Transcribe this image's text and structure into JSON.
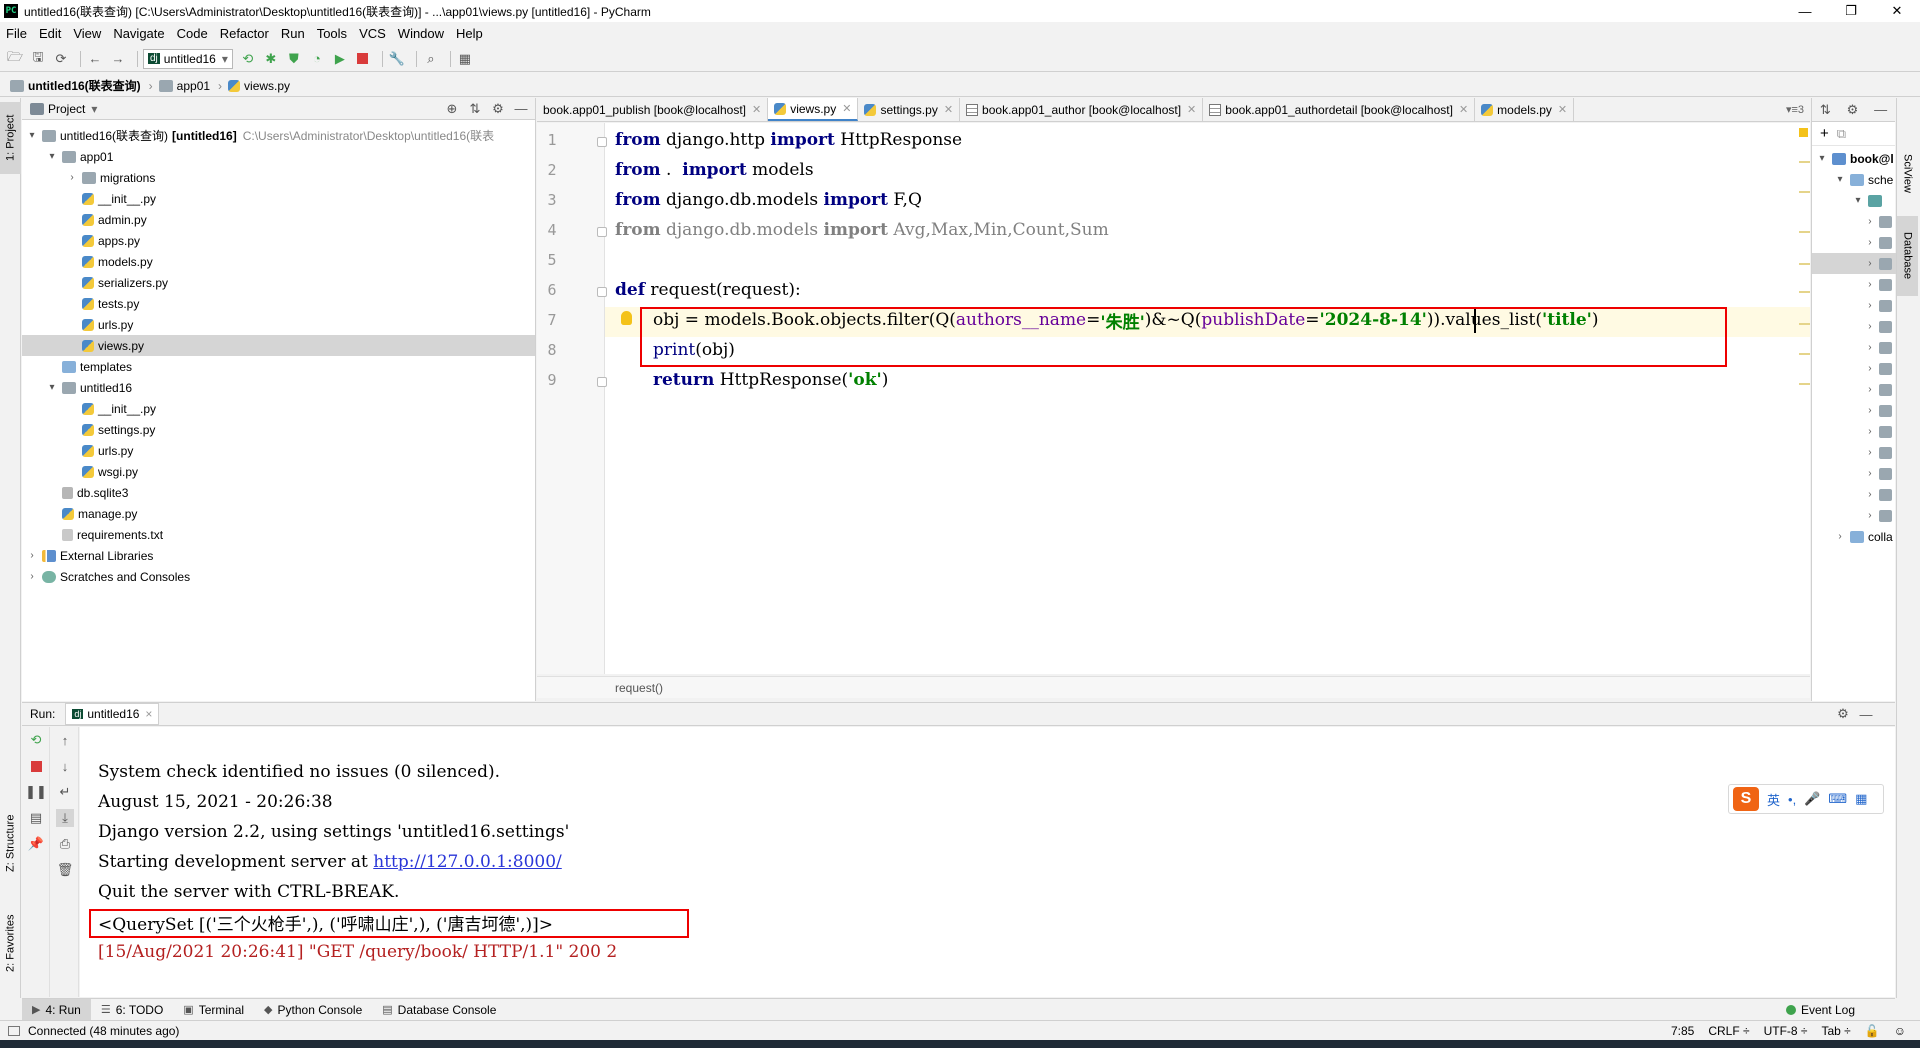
{
  "window": {
    "app_icon": "PC",
    "title": "untitled16(联表查询) [C:\\Users\\Administrator\\Desktop\\untitled16(联表查询)] - ...\\app01\\views.py [untitled16] - PyCharm",
    "minimize": "—",
    "restore": "❐",
    "close": "✕"
  },
  "menu": [
    "File",
    "Edit",
    "View",
    "Navigate",
    "Code",
    "Refactor",
    "Run",
    "Tools",
    "VCS",
    "Window",
    "Help"
  ],
  "toolbar": {
    "run_config": "untitled16",
    "run_config_arrow": "▾"
  },
  "navbar": {
    "crumbs": [
      "untitled16(联表查询)",
      "app01",
      "views.py"
    ]
  },
  "left_stripe": {
    "project": "1: Project",
    "structure": "Z: Structure",
    "favorites": "2: Favorites"
  },
  "project_panel": {
    "title": "Project",
    "title_arrow": "▾",
    "tree": [
      {
        "indent": 0,
        "arrow": "▾",
        "icon": "folder",
        "label": "untitled16(联表查询)",
        "bold_suffix": "[untitled16]",
        "path": "C:\\Users\\Administrator\\Desktop\\untitled16(联表"
      },
      {
        "indent": 1,
        "arrow": "▾",
        "icon": "folder",
        "label": "app01"
      },
      {
        "indent": 2,
        "arrow": "›",
        "icon": "folder",
        "label": "migrations"
      },
      {
        "indent": 2,
        "arrow": "",
        "icon": "py",
        "label": "__init__.py"
      },
      {
        "indent": 2,
        "arrow": "",
        "icon": "py",
        "label": "admin.py"
      },
      {
        "indent": 2,
        "arrow": "",
        "icon": "py",
        "label": "apps.py"
      },
      {
        "indent": 2,
        "arrow": "",
        "icon": "py",
        "label": "models.py"
      },
      {
        "indent": 2,
        "arrow": "",
        "icon": "py",
        "label": "serializers.py"
      },
      {
        "indent": 2,
        "arrow": "",
        "icon": "py",
        "label": "tests.py"
      },
      {
        "indent": 2,
        "arrow": "",
        "icon": "py",
        "label": "urls.py"
      },
      {
        "indent": 2,
        "arrow": "",
        "icon": "py",
        "label": "views.py",
        "selected": true
      },
      {
        "indent": 1,
        "arrow": "",
        "icon": "folder",
        "label": "templates"
      },
      {
        "indent": 1,
        "arrow": "▾",
        "icon": "folder",
        "label": "untitled16"
      },
      {
        "indent": 2,
        "arrow": "",
        "icon": "py",
        "label": "__init__.py"
      },
      {
        "indent": 2,
        "arrow": "",
        "icon": "py",
        "label": "settings.py"
      },
      {
        "indent": 2,
        "arrow": "",
        "icon": "py",
        "label": "urls.py"
      },
      {
        "indent": 2,
        "arrow": "",
        "icon": "py",
        "label": "wsgi.py"
      },
      {
        "indent": 1,
        "arrow": "",
        "icon": "db",
        "label": "db.sqlite3"
      },
      {
        "indent": 1,
        "arrow": "",
        "icon": "py",
        "label": "manage.py"
      },
      {
        "indent": 1,
        "arrow": "",
        "icon": "file",
        "label": "requirements.txt"
      },
      {
        "indent": 0,
        "arrow": "›",
        "icon": "lib",
        "label": "External Libraries"
      },
      {
        "indent": 0,
        "arrow": "›",
        "icon": "scratch",
        "label": "Scratches and Consoles"
      }
    ]
  },
  "editor_tabs": [
    {
      "label": "book.app01_publish [book@localhost]",
      "icon": "none"
    },
    {
      "label": "views.py",
      "icon": "py",
      "active": true
    },
    {
      "label": "settings.py",
      "icon": "py"
    },
    {
      "label": "book.app01_author [book@localhost]",
      "icon": "tbl"
    },
    {
      "label": "book.app01_authordetail [book@localhost]",
      "icon": "tbl"
    },
    {
      "label": "models.py",
      "icon": "py"
    }
  ],
  "tabs_more": "▾≡3",
  "editor": {
    "line_numbers": [
      "1",
      "2",
      "3",
      "4",
      "5",
      "6",
      "7",
      "8",
      "9"
    ],
    "code": {
      "l1": {
        "kw1": "from",
        "mod": " django.http ",
        "kw2": "import",
        "name": " HttpResponse"
      },
      "l2": {
        "kw1": "from",
        "mod": " .  ",
        "kw2": "import",
        "name": " models"
      },
      "l3": {
        "kw1": "from",
        "mod": " django.db.models ",
        "kw2": "import",
        "name": " F,Q"
      },
      "l4": {
        "kw1": "from",
        "mod": " django.db.models ",
        "kw2": "import",
        "name": " Avg,Max,Min,Count,Sum"
      },
      "l6": {
        "kw": "def",
        "sig": " request(request):"
      },
      "l7": {
        "p1": "obj = models.Book.objects.filter(Q(",
        "param1": "authors__name",
        "eq1": "=",
        "str1": "'朱胜'",
        "p2": ")&~Q(",
        "param2": "publishDate",
        "eq2": "=",
        "str2": "'2024-8-14'",
        "p3": ")).values_list(",
        "str3": "'title'",
        "p4": ")"
      },
      "l8": {
        "fn": "print",
        "rest": "(obj)"
      },
      "l9": {
        "kw": "return",
        "rest": " HttpResponse(",
        "str": "'ok'",
        "end": ")"
      }
    }
  },
  "editor_breadcrumb": "request()",
  "right_panel": {
    "add": "+",
    "copy": "⧉",
    "root_label": "book@l",
    "schema_label": "sche",
    "collations_label": "colla"
  },
  "right_stripe": {
    "sciview": "SciView",
    "database": "Database"
  },
  "run_panel": {
    "label": "Run:",
    "tab": "untitled16",
    "tab_close": "×",
    "console": {
      "l1": "System check identified no issues (0 silenced).",
      "l2": "August 15, 2021 - 20:26:38",
      "l3": "Django version 2.2, using settings 'untitled16.settings'",
      "l4_prefix": "Starting development server at ",
      "l4_link": "http://127.0.0.1:8000/",
      "l5": "Quit the server with CTRL-BREAK.",
      "l6": "<QuerySet [('三个火枪手',), ('呼啸山庄',), ('唐吉坷德',)]>",
      "l7": "[15/Aug/2021 20:26:41] \"GET /query/book/ HTTP/1.1\" 200 2"
    },
    "ime": {
      "logo": "S",
      "lang": "英",
      "punct": "•,",
      "mic": "🎤",
      "kbd": "⌨",
      "grid": "▦"
    }
  },
  "bottom_tabs": [
    {
      "label": "4: Run",
      "icon": "▶",
      "active": true
    },
    {
      "label": "6: TODO",
      "icon": "☰"
    },
    {
      "label": "Terminal",
      "icon": "▣"
    },
    {
      "label": "Python Console",
      "icon": "◆"
    },
    {
      "label": "Database Console",
      "icon": "▤"
    }
  ],
  "event_log": "Event Log",
  "statusbar": {
    "message": "Connected (48 minutes ago)",
    "position": "7:85",
    "line_sep": "CRLF ÷",
    "encoding": "UTF-8 ÷",
    "indent": "Tab ÷"
  },
  "colors": {
    "accent_blue": "#4083c9",
    "highlight_red": "#ee0000",
    "keyword": "#000080",
    "string": "#008080",
    "console_red": "#b42020"
  }
}
